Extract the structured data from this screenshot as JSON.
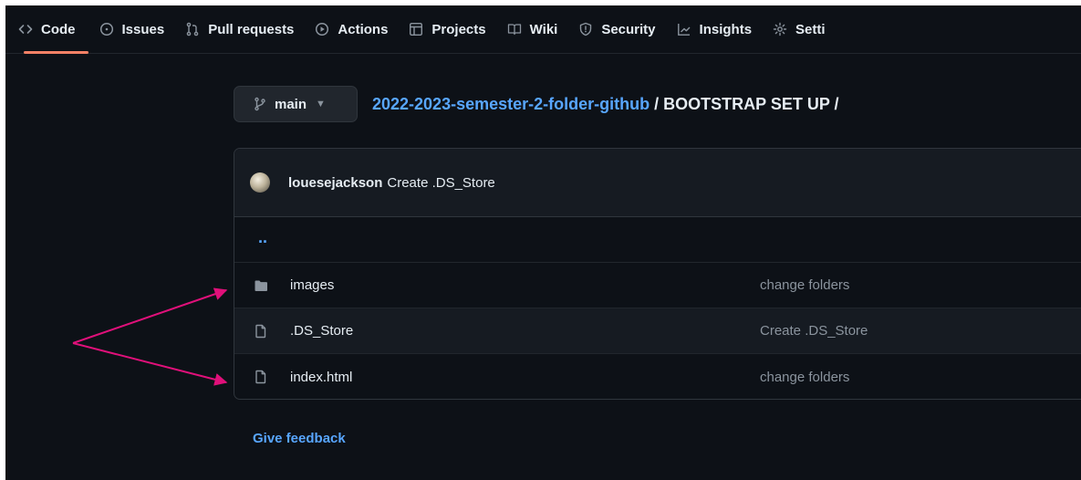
{
  "nav": {
    "items": [
      {
        "label": "Code",
        "icon": "code-icon"
      },
      {
        "label": "Issues",
        "icon": "issue-opened-icon"
      },
      {
        "label": "Pull requests",
        "icon": "git-pull-request-icon"
      },
      {
        "label": "Actions",
        "icon": "play-icon"
      },
      {
        "label": "Projects",
        "icon": "table-icon"
      },
      {
        "label": "Wiki",
        "icon": "book-icon"
      },
      {
        "label": "Security",
        "icon": "shield-icon"
      },
      {
        "label": "Insights",
        "icon": "graph-icon"
      },
      {
        "label": "Setti",
        "icon": "gear-icon"
      }
    ],
    "active_color": "#f78166"
  },
  "branch": {
    "name": "main",
    "icon": "git-branch-icon"
  },
  "breadcrumb": {
    "repo": "2022-2023-semester-2-folder-github",
    "separator": "/",
    "folder": "BOOTSTRAP SET UP",
    "trailing": "/"
  },
  "latest_commit": {
    "author": "louesejackson",
    "message": "Create .DS_Store"
  },
  "files": {
    "parent": "..",
    "rows": [
      {
        "name": "images",
        "type": "folder",
        "icon": "file-directory-icon",
        "commit": "change folders"
      },
      {
        "name": ".DS_Store",
        "type": "file",
        "icon": "file-icon",
        "commit": "Create .DS_Store"
      },
      {
        "name": "index.html",
        "type": "file",
        "icon": "file-icon",
        "commit": "change folders"
      }
    ]
  },
  "feedback": {
    "label": "Give feedback"
  },
  "annotation": {
    "arrow_color": "#e0107a"
  },
  "colors": {
    "background": "#0d1117",
    "link": "#58a6ff",
    "text": "#e6edf3",
    "muted": "#8b949e",
    "border": "#30363d"
  }
}
